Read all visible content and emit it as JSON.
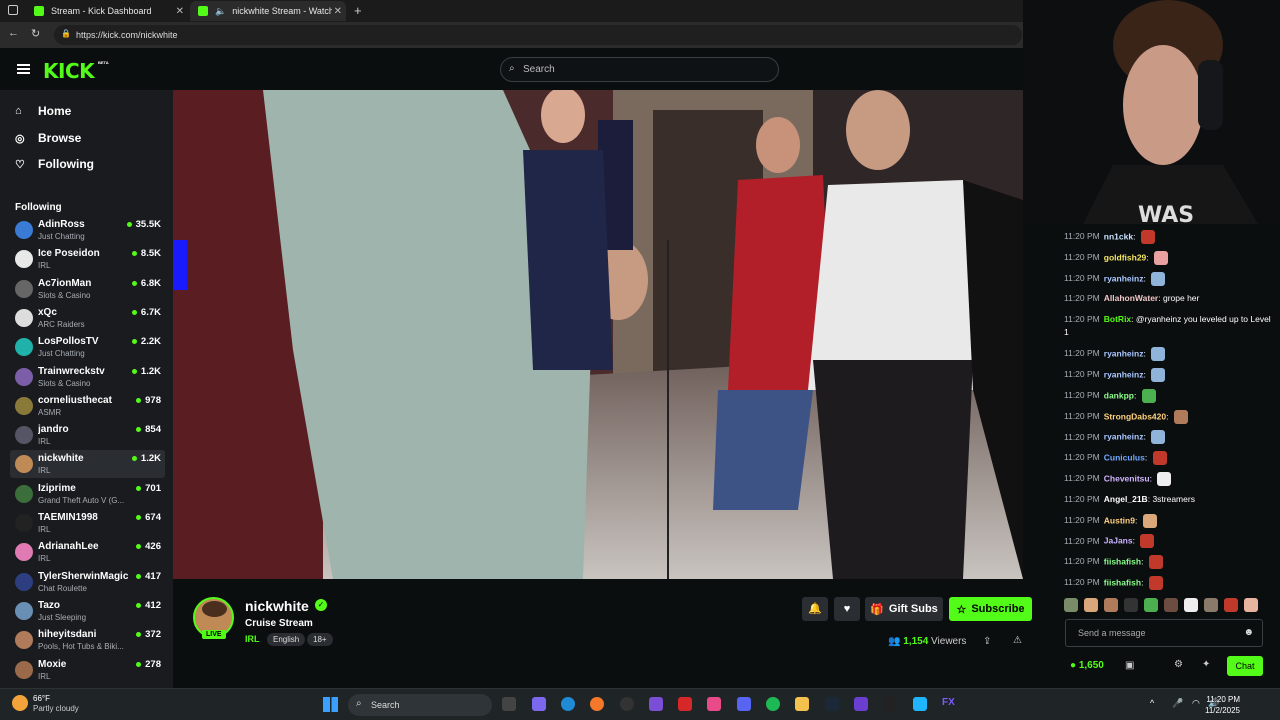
{
  "browser": {
    "tabs": [
      {
        "title": "Stream - Kick Dashboard"
      },
      {
        "title": "nickwhite Stream - Watch Li..."
      }
    ],
    "url": "https://kick.com/nickwhite"
  },
  "header": {
    "logo": "KICK",
    "beta": "BETA",
    "search_placeholder": "Search"
  },
  "sidebar": {
    "nav": [
      {
        "label": "Home",
        "icon": "home-icon"
      },
      {
        "label": "Browse",
        "icon": "browse-icon"
      },
      {
        "label": "Following",
        "icon": "heart-icon"
      }
    ],
    "following_title": "Following",
    "channels": [
      {
        "name": "AdinRoss",
        "category": "Just Chatting",
        "viewers": "35.5K",
        "color": "#3a7bd5"
      },
      {
        "name": "Ice Poseidon",
        "category": "IRL",
        "viewers": "8.5K",
        "color": "#e8e8e8"
      },
      {
        "name": "Ac7ionMan",
        "category": "Slots & Casino",
        "viewers": "6.8K",
        "color": "#666"
      },
      {
        "name": "xQc",
        "category": "ARC Raiders",
        "viewers": "6.7K",
        "color": "#ddd"
      },
      {
        "name": "LosPollosTV",
        "category": "Just Chatting",
        "viewers": "2.2K",
        "color": "#20b2aa"
      },
      {
        "name": "Trainwreckstv",
        "category": "Slots & Casino",
        "viewers": "1.2K",
        "color": "#7b5ea7"
      },
      {
        "name": "corneliusthecat",
        "category": "ASMR",
        "viewers": "978",
        "color": "#8a7a3a"
      },
      {
        "name": "jandro",
        "category": "IRL",
        "viewers": "854",
        "color": "#556"
      },
      {
        "name": "nickwhite",
        "category": "IRL",
        "viewers": "1.2K",
        "color": "#c08a57"
      },
      {
        "name": "Iziprime",
        "category": "Grand Theft Auto V (G...",
        "viewers": "701",
        "color": "#3b6e3b"
      },
      {
        "name": "TAEMIN1998",
        "category": "IRL",
        "viewers": "674",
        "color": "#222"
      },
      {
        "name": "AdrianahLee",
        "category": "IRL",
        "viewers": "426",
        "color": "#e07ab2"
      },
      {
        "name": "TylerSherwinMagic",
        "category": "Chat Roulette",
        "viewers": "417",
        "color": "#2c3e80"
      },
      {
        "name": "Tazo",
        "category": "Just Sleeping",
        "viewers": "412",
        "color": "#6a8fb5"
      },
      {
        "name": "hiheyitsdani",
        "category": "Pools, Hot Tubs & Biki...",
        "viewers": "372",
        "color": "#b07b5a"
      },
      {
        "name": "Moxie",
        "category": "IRL",
        "viewers": "278",
        "color": "#9b6a4a"
      }
    ]
  },
  "stream": {
    "name": "nickwhite",
    "live": "LIVE",
    "title": "Cruise Stream",
    "category": "IRL",
    "tags": [
      "English",
      "18+"
    ],
    "gift_label": "Gift Subs",
    "subscribe_label": "Subscribe",
    "viewer_count": "1,154",
    "viewer_suffix": "Viewers"
  },
  "chat": {
    "messages": [
      {
        "time": "11:20 PM",
        "user": "nn1ckk",
        "text": "",
        "color": "#c9e4ff",
        "emote": "#c0392b"
      },
      {
        "time": "11:20 PM",
        "user": "goldfish29",
        "text": "",
        "color": "#f5e663",
        "emote": "#e8a0a0"
      },
      {
        "time": "11:20 PM",
        "user": "ryanheinz",
        "text": "",
        "color": "#a9c7ff",
        "emote": "#8fb3d9"
      },
      {
        "time": "11:20 PM",
        "user": "AllahonWater",
        "text": "grope her",
        "color": "#f0c7c7",
        "emote": ""
      },
      {
        "time": "11:20 PM",
        "user": "BotRix",
        "text": "@ryanheinz you leveled up to Level 1",
        "color": "#53fc18",
        "emote": ""
      },
      {
        "time": "11:20 PM",
        "user": "ryanheinz",
        "text": "",
        "color": "#a9c7ff",
        "emote": "#8fb3d9"
      },
      {
        "time": "11:20 PM",
        "user": "ryanheinz",
        "text": "",
        "color": "#a9c7ff",
        "emote": "#8fb3d9"
      },
      {
        "time": "11:20 PM",
        "user": "dankpp",
        "text": "",
        "color": "#8cff8c",
        "emote": "#4caf50"
      },
      {
        "time": "11:20 PM",
        "user": "StrongDabs420",
        "text": "",
        "color": "#ffd27f",
        "emote": "#b07b5a"
      },
      {
        "time": "11:20 PM",
        "user": "ryanheinz",
        "text": "",
        "color": "#a9c7ff",
        "emote": "#8fb3d9"
      },
      {
        "time": "11:20 PM",
        "user": "Cuniculus",
        "text": "",
        "color": "#6fa8ff",
        "emote": "#c0392b"
      },
      {
        "time": "11:20 PM",
        "user": "Chevenitsu",
        "text": "",
        "color": "#d0b3ff",
        "emote": "#eeeeee"
      },
      {
        "time": "11:20 PM",
        "user": "Angel_21B",
        "text": "3streamers",
        "color": "#ffffff",
        "emote": ""
      },
      {
        "time": "11:20 PM",
        "user": "Austin9",
        "text": "",
        "color": "#ffd27f",
        "emote": "#d9a77a"
      },
      {
        "time": "11:20 PM",
        "user": "JaJans",
        "text": "",
        "color": "#c9b3ff",
        "emote": "#c0392b"
      },
      {
        "time": "11:20 PM",
        "user": "fiishafish",
        "text": "",
        "color": "#8cff8c",
        "emote": "#c0392b"
      },
      {
        "time": "11:20 PM",
        "user": "fiishafish",
        "text": "",
        "color": "#8cff8c",
        "emote": "#c0392b"
      }
    ],
    "emote_bar": [
      "#7a8b6a",
      "#d9a77a",
      "#b07b5a",
      "#333",
      "#4caf50",
      "#6d4c41",
      "#eeeeee",
      "#8a7a6a",
      "#c0392b",
      "#e8b4a0"
    ],
    "input_placeholder": "Send a message",
    "points": "1,650",
    "chat_button": "Chat"
  },
  "taskbar": {
    "temp": "66°F",
    "weather": "Partly cloudy",
    "search": "Search",
    "time": "11:20 PM",
    "date": "11/2/2025"
  }
}
